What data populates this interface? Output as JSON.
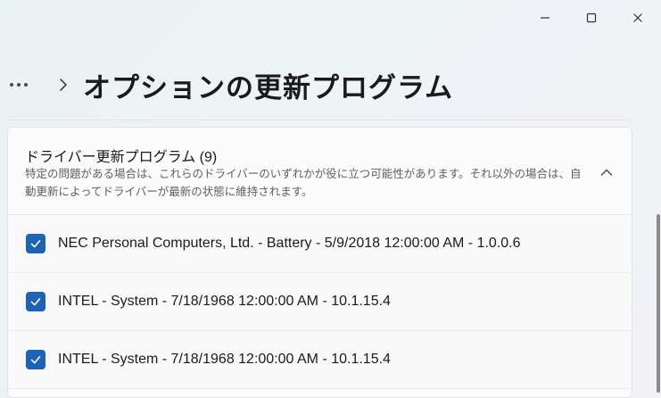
{
  "window": {
    "minimize_icon": "minimize-icon",
    "maximize_icon": "maximize-icon",
    "close_icon": "close-icon"
  },
  "header": {
    "more_icon": "more-dots-icon",
    "separator_icon": "chevron-right-icon",
    "title": "オプションの更新プログラム"
  },
  "driver_updates": {
    "title": "ドライバー更新プログラム (9)",
    "description": "特定の問題がある場合は、これらのドライバーのいずれかが役に立つ可能性があります。それ以外の場合は、自動更新によってドライバーが最新の状態に維持されます。",
    "expanded": true,
    "items": [
      {
        "label": "NEC Personal Computers, Ltd. - Battery - 5/9/2018 12:00:00 AM - 1.0.0.6",
        "checked": true
      },
      {
        "label": "INTEL - System - 7/18/1968 12:00:00 AM - 10.1.15.4",
        "checked": true
      },
      {
        "label": "INTEL - System - 7/18/1968 12:00:00 AM - 10.1.15.4",
        "checked": true
      }
    ]
  },
  "colors": {
    "accent": "#1e62b8",
    "card_background": "#fbfbfb",
    "secondary_text": "#5f5f5f"
  }
}
